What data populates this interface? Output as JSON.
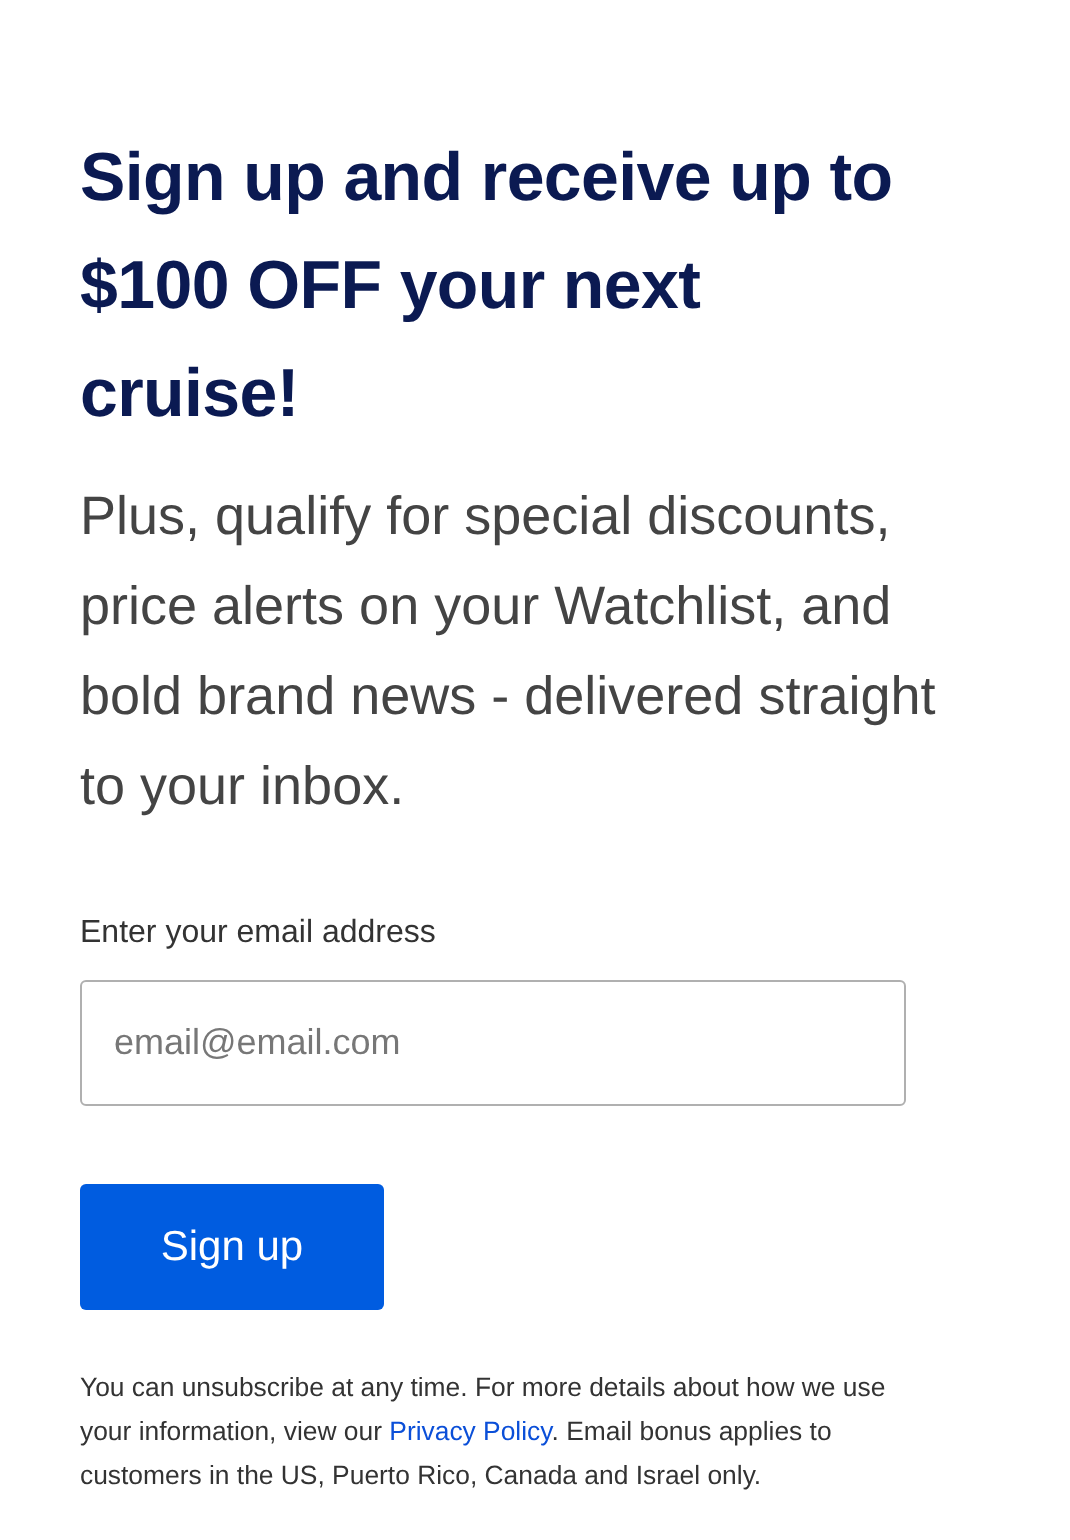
{
  "heading": "Sign up and receive up to $100 OFF your next cruise!",
  "intro": "Plus, qualify for special discounts, price alerts on your Watchlist, and bold brand news - delivered straight to your inbox.",
  "email_field": {
    "label": "Enter your email address",
    "placeholder": "email@email.com"
  },
  "submit_button": "Sign up",
  "disclaimer": {
    "before": "You can unsubscribe at any time. For more details about how we use your information, view our",
    "link": "Privacy Policy",
    "after": ". Email bonus applies to customers in the US, Puerto Rico, Canada and Israel only."
  }
}
